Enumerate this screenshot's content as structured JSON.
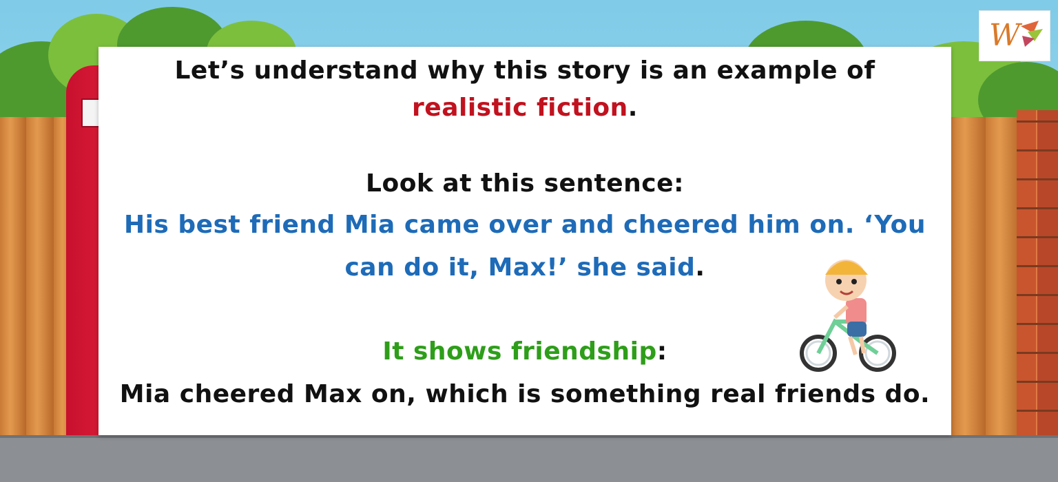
{
  "slide": {
    "title_line1": "Let’s understand why this story is an example of",
    "title_term": "realistic fiction",
    "title_end": ".",
    "prompt": "Look at this sentence:",
    "quote_line1": "His best friend Mia came over and cheered him on. ‘You",
    "quote_line2": "can do it, Max!’ she said",
    "quote_end": ".",
    "trait_label": "It shows friendship",
    "trait_colon": ":",
    "explanation": "Mia cheered Max on, which is something real friends do."
  },
  "logo": {
    "text": "W"
  },
  "colors": {
    "term": "#c1121f",
    "quote": "#1e6bb8",
    "trait": "#2e9e1a",
    "text": "#111111"
  },
  "icons": {
    "illustration": "boy-on-bicycle-icon",
    "brand": "logo-icon",
    "background": "phone-booth-fence-scene"
  }
}
